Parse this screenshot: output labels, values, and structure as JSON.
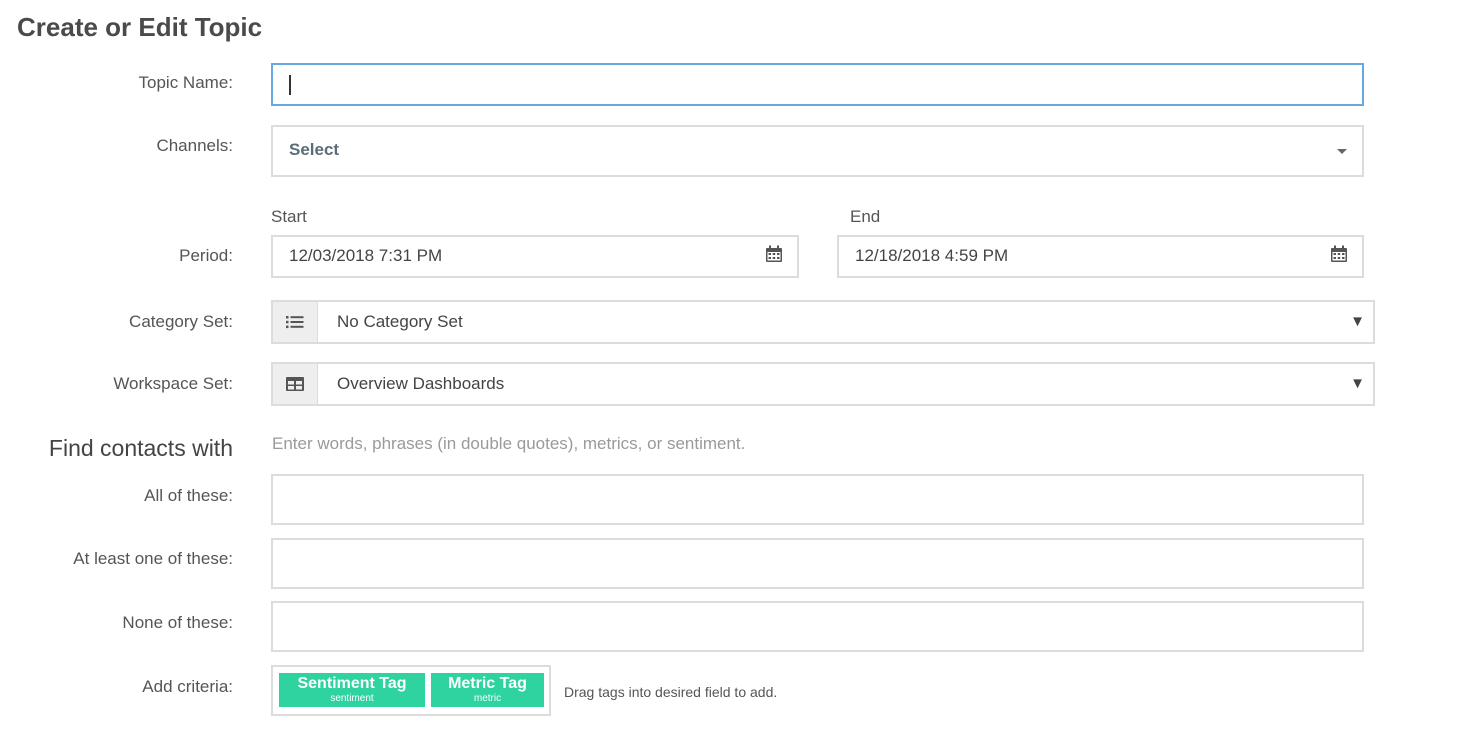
{
  "title": "Create or Edit Topic",
  "topic_name": {
    "label": "Topic Name:",
    "value": ""
  },
  "channels": {
    "label": "Channels:",
    "selected": "Select"
  },
  "period": {
    "label": "Period:",
    "start_label": "Start",
    "end_label": "End",
    "start_value": "12/03/2018 7:31 PM",
    "end_value": "12/18/2018 4:59 PM"
  },
  "category_set": {
    "label": "Category Set:",
    "selected": "No Category Set",
    "icon": "list-icon"
  },
  "workspace_set": {
    "label": "Workspace Set:",
    "selected": "Overview Dashboards",
    "icon": "table-icon"
  },
  "find_contacts": {
    "heading": "Find contacts with",
    "hint": "Enter words, phrases (in double quotes), metrics, or sentiment.",
    "all_label": "All of these:",
    "any_label": "At least one of these:",
    "none_label": "None of these:"
  },
  "add_criteria": {
    "label": "Add criteria:",
    "tags": [
      {
        "title": "Sentiment Tag",
        "subtitle": "sentiment"
      },
      {
        "title": "Metric Tag",
        "subtitle": "metric"
      }
    ],
    "hint": "Drag tags into desired field to add."
  },
  "colors": {
    "tag": "#2fd3a0",
    "focus_border": "#69a7e3",
    "border": "#dcdcdc"
  }
}
